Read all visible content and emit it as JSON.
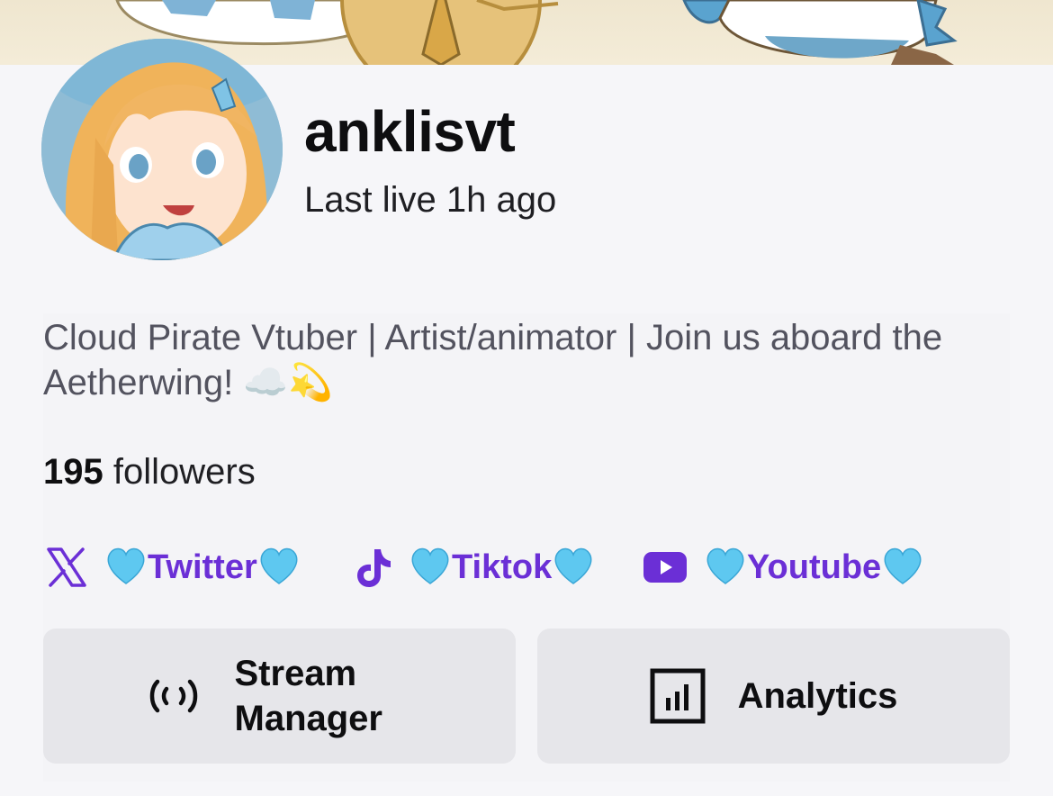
{
  "profile": {
    "username": "anklisvt",
    "last_live": "Last live 1h ago",
    "bio": "Cloud Pirate Vtuber | Artist/animator | Join us aboard the Aetherwing! ☁️💫",
    "followers_count": "195",
    "followers_label": " followers"
  },
  "socials": [
    {
      "label": "Twitter",
      "icon": "x-icon"
    },
    {
      "label": "Tiktok",
      "icon": "tiktok-icon"
    },
    {
      "label": "Youtube",
      "icon": "youtube-icon"
    }
  ],
  "actions": {
    "stream_manager": "Stream Manager",
    "analytics": "Analytics"
  },
  "colors": {
    "link": "#6b2fd6",
    "heart": "#5ec8f0",
    "button_bg": "#e6e6ea"
  }
}
